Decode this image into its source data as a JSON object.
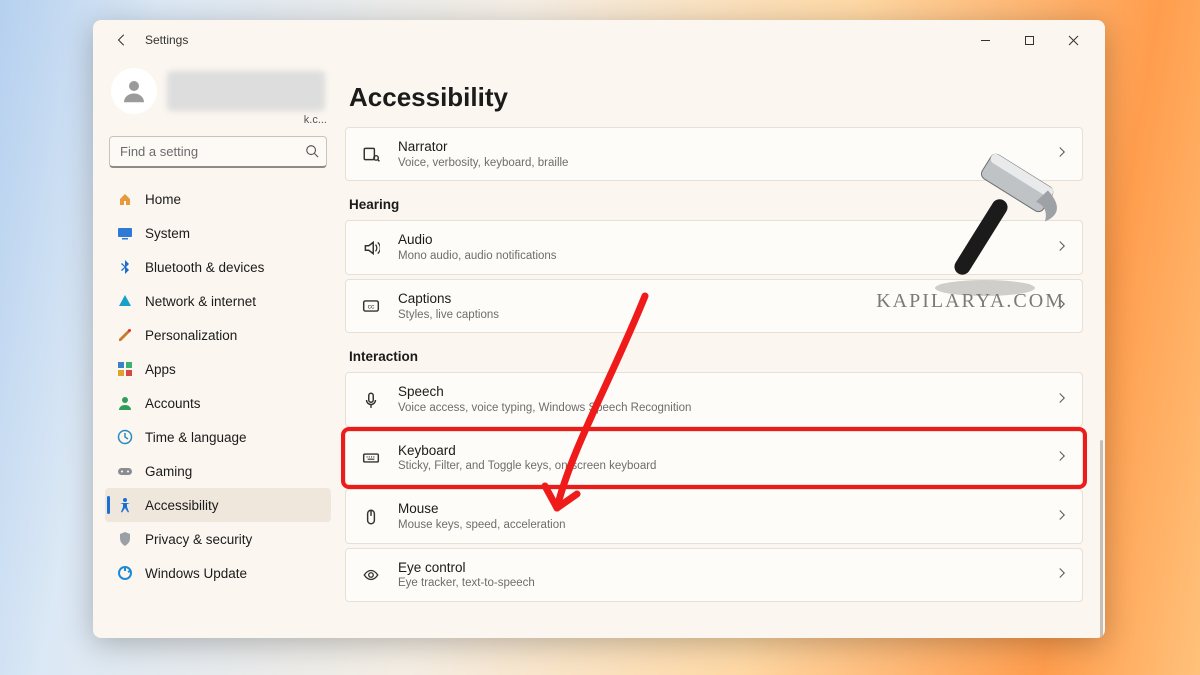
{
  "window": {
    "app_title": "Settings",
    "user_email_fragment": "k.c..."
  },
  "search": {
    "placeholder": "Find a setting"
  },
  "sidebar": {
    "items": [
      {
        "label": "Home",
        "icon": "home"
      },
      {
        "label": "System",
        "icon": "system"
      },
      {
        "label": "Bluetooth & devices",
        "icon": "bluetooth"
      },
      {
        "label": "Network & internet",
        "icon": "network"
      },
      {
        "label": "Personalization",
        "icon": "personalization"
      },
      {
        "label": "Apps",
        "icon": "apps"
      },
      {
        "label": "Accounts",
        "icon": "accounts"
      },
      {
        "label": "Time & language",
        "icon": "time"
      },
      {
        "label": "Gaming",
        "icon": "gaming"
      },
      {
        "label": "Accessibility",
        "icon": "accessibility",
        "selected": true
      },
      {
        "label": "Privacy & security",
        "icon": "privacy"
      },
      {
        "label": "Windows Update",
        "icon": "update"
      }
    ]
  },
  "page": {
    "title": "Accessibility",
    "groups": [
      {
        "label": "",
        "items": [
          {
            "key": "narrator",
            "title": "Narrator",
            "subtitle": "Voice, verbosity, keyboard, braille",
            "icon": "narrator"
          }
        ]
      },
      {
        "label": "Hearing",
        "items": [
          {
            "key": "audio",
            "title": "Audio",
            "subtitle": "Mono audio, audio notifications",
            "icon": "audio"
          },
          {
            "key": "captions",
            "title": "Captions",
            "subtitle": "Styles, live captions",
            "icon": "captions"
          }
        ]
      },
      {
        "label": "Interaction",
        "items": [
          {
            "key": "speech",
            "title": "Speech",
            "subtitle": "Voice access, voice typing, Windows Speech Recognition",
            "icon": "speech"
          },
          {
            "key": "keyboard",
            "title": "Keyboard",
            "subtitle": "Sticky, Filter, and Toggle keys, on-screen keyboard",
            "icon": "keyboard",
            "highlighted": true
          },
          {
            "key": "mouse",
            "title": "Mouse",
            "subtitle": "Mouse keys, speed, acceleration",
            "icon": "mouse"
          },
          {
            "key": "eyecontrol",
            "title": "Eye control",
            "subtitle": "Eye tracker, text-to-speech",
            "icon": "eye"
          }
        ]
      }
    ]
  },
  "watermark": "KAPILARYA.COM"
}
